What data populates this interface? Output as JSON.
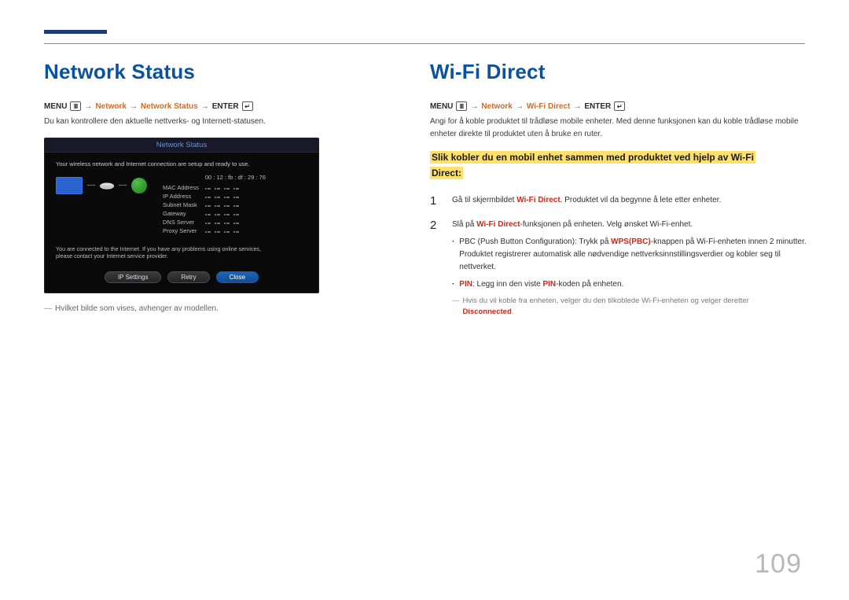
{
  "page_number": "109",
  "left": {
    "heading": "Network Status",
    "breadcrumb": {
      "menu": "MENU",
      "p1": "Network",
      "p2": "Network Status",
      "enter": "ENTER"
    },
    "desc": "Du kan kontrollere den aktuelle nettverks- og Internett-statusen.",
    "panel": {
      "title": "Network Status",
      "line1": "Your wireless network and Internet connection are setup and ready to use.",
      "kv_header": "00 : 12 : fb : df : 29 : 76",
      "rows": [
        "MAC Address",
        "IP Address",
        "Subnet Mask",
        "Gateway",
        "DNS Server",
        "Proxy Server"
      ],
      "line2a": "You are connected to the Internet. If you have any problems using online services,",
      "line2b": "please contact your Internet service provider.",
      "btn_ip": "IP Settings",
      "btn_retry": "Retry",
      "btn_close": "Close"
    },
    "caption": "Hvilket bilde som vises, avhenger av modellen."
  },
  "right": {
    "heading": "Wi-Fi Direct",
    "breadcrumb": {
      "menu": "MENU",
      "p1": "Network",
      "p2": "Wi-Fi Direct",
      "enter": "ENTER"
    },
    "desc": "Angi for å koble produktet til trådløse mobile enheter. Med denne funksjonen kan du koble trådløse mobile enheter direkte til produktet uten å bruke en ruter.",
    "highlight": "Slik kobler du en mobil enhet sammen med produktet ved hjelp av Wi-Fi Direct:",
    "steps": [
      {
        "num": "1",
        "pre1": "Gå til skjermbildet ",
        "red1": "Wi-Fi Direct",
        "post1": ". Produktet vil da begynne å lete etter enheter."
      },
      {
        "num": "2",
        "pre1": "Slå på ",
        "red1": "Wi-Fi Direct",
        "post1": "-funksjonen på enheten. Velg ønsket Wi-Fi-enhet.",
        "bullets": [
          {
            "pre": "PBC (Push Button Configuration): Trykk på ",
            "red": "WPS(PBC)",
            "post": "-knappen på Wi-Fi-enheten innen 2 minutter. Produktet registrerer automatisk alle nødvendige nettverksinnstillingsverdier og kobler seg til nettverket."
          },
          {
            "preRed": "PIN",
            "mid": ": Legg inn den viste ",
            "red": "PIN",
            "post": "-koden på enheten."
          }
        ]
      }
    ],
    "note_grey": "Hvis du vil koble fra enheten, velger du den tilkoblede Wi-Fi-enheten og velger deretter ",
    "note_red": "Disconnected",
    "note_end": "."
  }
}
